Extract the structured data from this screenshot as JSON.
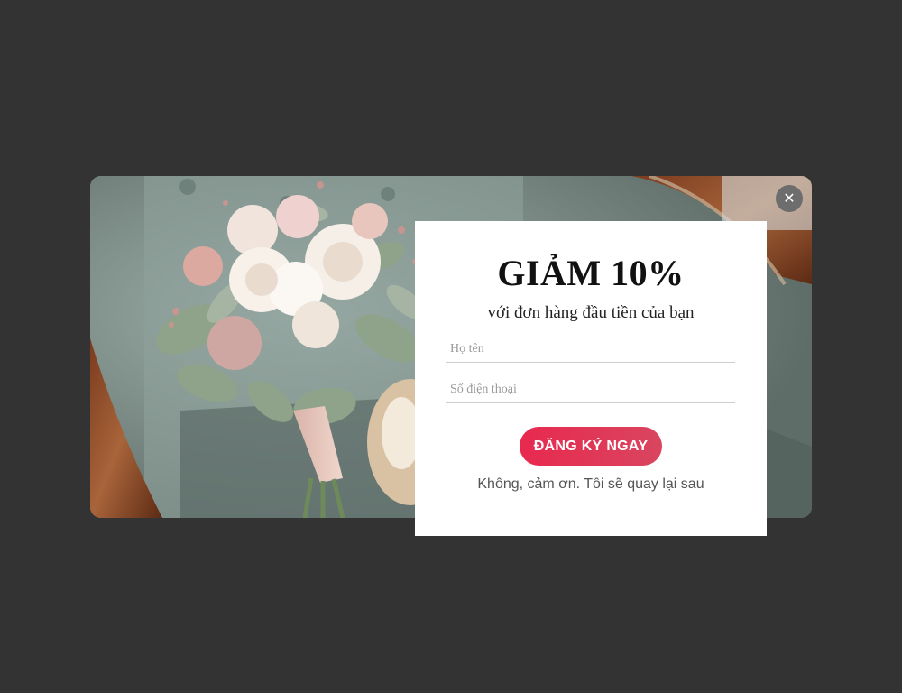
{
  "popup": {
    "image_alt": "bridal bouquet",
    "close_icon": "close-icon",
    "headline": "GIẢM 10%",
    "subline": "với đơn hàng đầu tiền của bạn",
    "fields": {
      "name_placeholder": "Họ tên",
      "name_value": "",
      "phone_placeholder": "Số điện thoại",
      "phone_value": ""
    },
    "submit_label": "ĐĂNG KÝ NGAY",
    "decline_label": "Không, cảm ơn. Tôi sẽ quay lại sau"
  },
  "colors": {
    "backdrop": "#333333",
    "accent": "#e8294f"
  }
}
